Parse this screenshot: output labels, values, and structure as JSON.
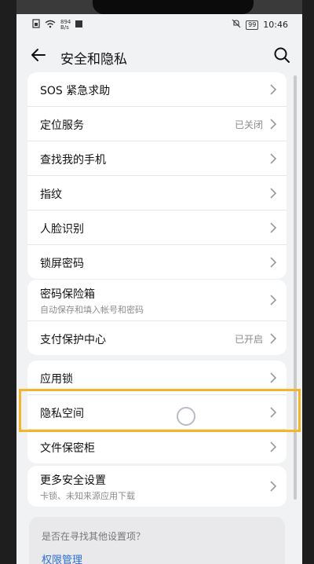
{
  "status": {
    "net_speed_top": "894",
    "net_speed_unit": "B/s",
    "battery": "99",
    "time": "10:46"
  },
  "header": {
    "title": "安全和隐私"
  },
  "groups": [
    {
      "items": [
        {
          "label": "SOS 紧急求助"
        },
        {
          "label": "定位服务",
          "value": "已关闭"
        },
        {
          "label": "查找我的手机"
        },
        {
          "label": "指纹"
        },
        {
          "label": "人脸识别"
        },
        {
          "label": "锁屏密码"
        }
      ]
    },
    {
      "items": [
        {
          "label": "密码保险箱",
          "sub": "自动保存和填入帐号和密码"
        },
        {
          "label": "支付保护中心",
          "value": "已开启"
        }
      ]
    },
    {
      "items": [
        {
          "label": "应用锁"
        },
        {
          "label": "隐私空间"
        },
        {
          "label": "文件保密柜"
        }
      ]
    },
    {
      "items": [
        {
          "label": "更多安全设置",
          "sub": "卡锁、未知来源应用下载"
        }
      ]
    }
  ],
  "hint": {
    "question": "是否在寻找其他设置项？",
    "link": "权限管理"
  },
  "colors": {
    "highlight": "#f4b52a",
    "link": "#2a6fd6"
  }
}
